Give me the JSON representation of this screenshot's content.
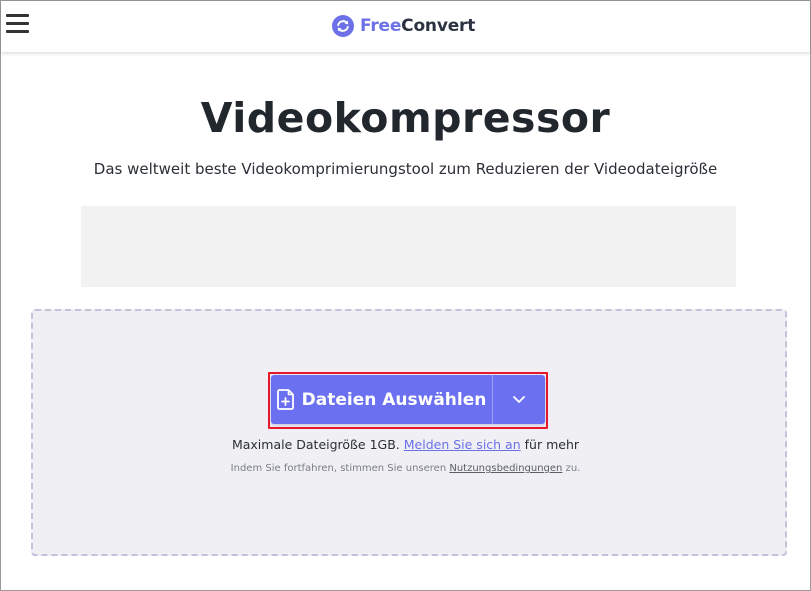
{
  "header": {
    "logo_free": "Free",
    "logo_convert": "Convert",
    "menu_icon": "hamburger-menu-icon",
    "logo_icon": "refresh-cycle-icon"
  },
  "main": {
    "title": "Videokompressor",
    "subtitle": "Das weltweit beste Videokomprimierungstool zum Reduzieren der Videodateigröße"
  },
  "upload": {
    "button_label": "Dateien Auswählen",
    "button_icon": "file-plus-icon",
    "dropdown_icon": "chevron-down-icon",
    "max_size_prefix": "Maximale Dateigröße 1GB.",
    "signup_link": "Melden Sie sich an",
    "max_size_suffix": "für mehr",
    "terms_prefix": "Indem Sie fortfahren, stimmen Sie unseren",
    "terms_link": "Nutzungsbedingungen",
    "terms_suffix": "zu."
  },
  "colors": {
    "accent": "#6c71e8",
    "button": "#6b70f0",
    "highlight": "#e8182c",
    "dropzone_bg": "#efeff4"
  }
}
